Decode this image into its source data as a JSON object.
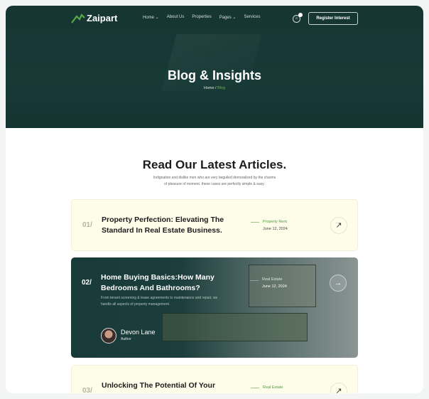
{
  "nav": {
    "logo": "Zaipart",
    "menu": [
      "Home ⌄",
      "About Us",
      "Properties",
      "Pages ⌄",
      "Services"
    ],
    "cart_count": "0",
    "register": "Register Interest"
  },
  "hero": {
    "title": "Blog & Insights",
    "breadcrumb_home": "Home",
    "breadcrumb_sep": " / ",
    "breadcrumb_current": "Blog"
  },
  "section": {
    "title": "Read Our Latest Articles.",
    "subtitle_1": "Indignation and dislike men who are very beguiled demoralized by the charms",
    "subtitle_2": "of pleasure of moment. these cases are perfectly simple & easy."
  },
  "articles": [
    {
      "number": "01/",
      "title": "Property Perfection: Elevating The Standard In Real Estate Business.",
      "category": "Property Rent",
      "date": "June 12, 2024"
    },
    {
      "number": "02/",
      "title": "Home Buying Basics:How Many Bedrooms And Bathrooms?",
      "category": "Real Estate",
      "date": "June 12, 2024",
      "description": "From tenant screening & lease agreements to maintenance and repair, we handle all aspects of property management.",
      "author_name": "Devon Lane",
      "author_role": "Author"
    },
    {
      "number": "03/",
      "title": "Unlocking The Potential Of Your",
      "category": "Real Estate"
    }
  ],
  "colors": {
    "dark": "#163533",
    "accent": "#4f9a3e",
    "card_bg": "#fdfdea"
  }
}
